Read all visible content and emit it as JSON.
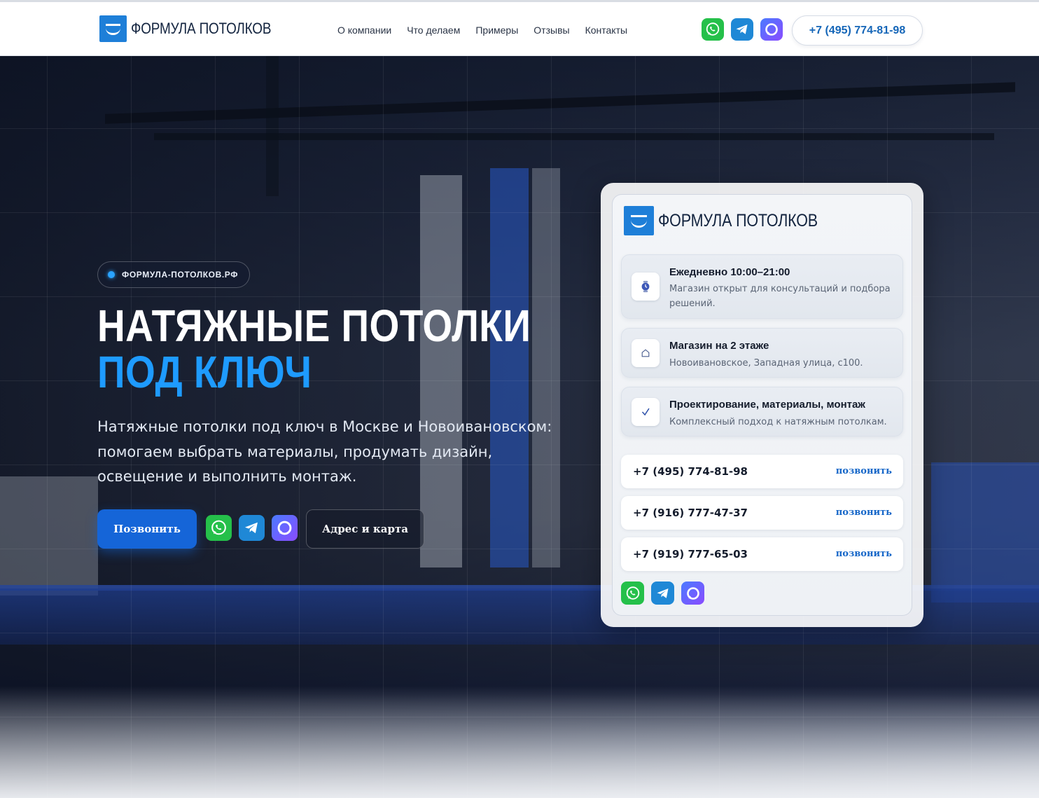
{
  "header": {
    "logo_text": "ФОРМУЛА ПОТОЛКОВ",
    "nav": [
      "О компании",
      "Что делаем",
      "Примеры",
      "Отзывы",
      "Контакты"
    ],
    "phone": "+7 (495) 774-81-98",
    "messengers": [
      "whatsapp-icon",
      "telegram-icon",
      "max-messenger-icon"
    ]
  },
  "hero": {
    "badge": "ФОРМУЛА-ПОТОЛКОВ.РФ",
    "title_line1": "НАТЯЖНЫЕ ПОТОЛКИ",
    "title_line2": "ПОД КЛЮЧ",
    "lead": "Натяжные потолки под ключ в Москве и Новоивановском: помогаем выбрать материалы, продумать дизайн, освещение и выполнить монтаж.",
    "call_button": "Позвонить",
    "map_button": "Адрес и карта"
  },
  "card": {
    "logo_text": "ФОРМУЛА ПОТОЛКОВ",
    "features": [
      {
        "icon": "clock-icon",
        "title": "Ежедневно 10:00–21:00",
        "desc": "Магазин открыт для консультаций и подбора решений."
      },
      {
        "icon": "home-icon",
        "title": "Магазин на 2 этаже",
        "desc": "Новоивановское, Западная улица, с100."
      },
      {
        "icon": "check-icon",
        "title": "Проектирование, материалы, монтаж",
        "desc": "Комплексный подход к натяжным потолкам."
      }
    ],
    "phones": [
      {
        "number": "+7 (495) 774-81-98",
        "action": "позвонить"
      },
      {
        "number": "+7 (916) 777-47-37",
        "action": "позвонить"
      },
      {
        "number": "+7 (919) 777-65-03",
        "action": "позвонить"
      }
    ]
  },
  "colors": {
    "brand_blue": "#1e7fd8",
    "accent_blue": "#1e9bff",
    "button_blue": "#1565d8",
    "whatsapp": "#25c04a",
    "telegram": "#1f88d6"
  }
}
